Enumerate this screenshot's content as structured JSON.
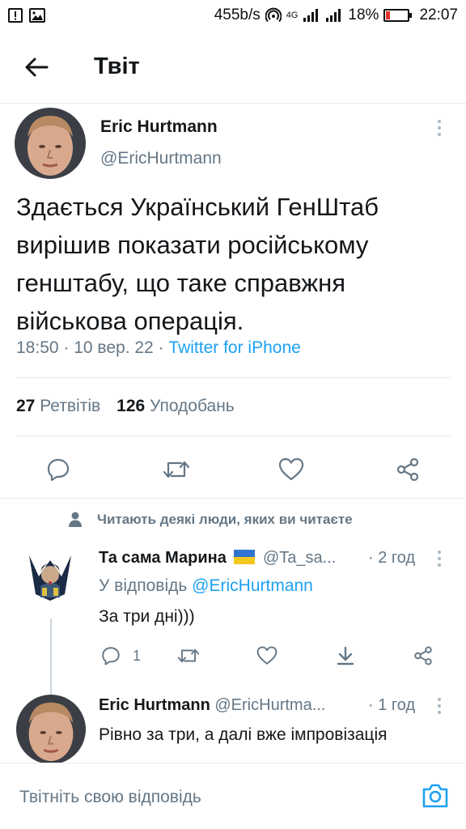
{
  "status_bar": {
    "network_speed": "455b/s",
    "signal_label": "4G",
    "battery_percent": "18%",
    "battery_level": 0.18,
    "time": "22:07"
  },
  "header": {
    "title": "Твіт"
  },
  "tweet": {
    "author_name": "Eric Hurtmann",
    "author_handle": "@EricHurtmann",
    "text": "Здається Український ГенШтаб вирішив показати російському генштабу, що таке справжня військова операція.",
    "time": "18:50",
    "date": "10 вер. 22",
    "source": "Twitter for iPhone",
    "retweets_count": "27",
    "retweets_label": "Ретвітів",
    "likes_count": "126",
    "likes_label": "Уподобань"
  },
  "social_context": "Читають деякі люди, яких ви читаєте",
  "replies": [
    {
      "name": "Та сама Марина",
      "flag": "🇺🇦",
      "handle": "@Ta_sa...",
      "time": "2 год",
      "reply_to_prefix": "У відповідь",
      "reply_to_handle": "@EricHurtmann",
      "text": "За три дні)))",
      "reply_count": "1"
    },
    {
      "name": "Eric Hurtmann",
      "handle": "@EricHurtma...",
      "time": "1 год",
      "text": "Рівно за три, а далі вже імпровізація"
    }
  ],
  "compose": {
    "placeholder": "Твітніть свою відповідь"
  },
  "colors": {
    "accent": "#1da1f2",
    "secondary_text": "#657786",
    "divider": "#e6ecf0"
  }
}
